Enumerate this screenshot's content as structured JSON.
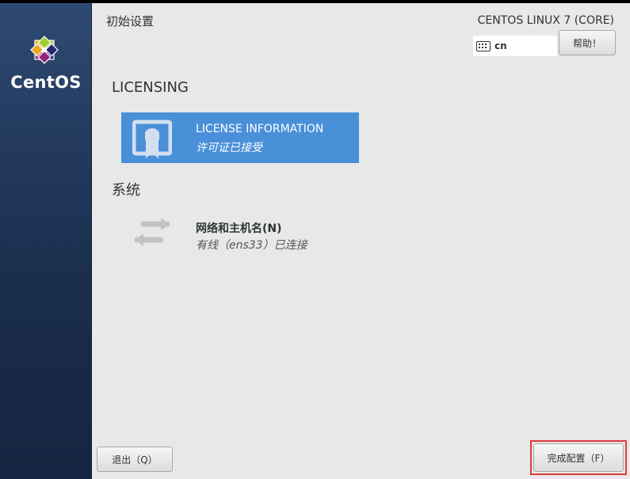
{
  "sidebar": {
    "brand": "CentOS"
  },
  "header": {
    "title": "初始设置",
    "product": "CENTOS LINUX 7 (CORE)",
    "keyboard_layout": "cn",
    "help_label": "帮助！"
  },
  "sections": [
    {
      "title": "LICENSING",
      "spokes": [
        {
          "title": "LICENSE INFORMATION",
          "status": "许可证已接受",
          "icon": "license-certificate-icon",
          "selected": true
        }
      ]
    },
    {
      "title": "系统",
      "spokes": [
        {
          "title": "网络和主机名(N)",
          "status": "有线（ens33）已连接",
          "icon": "network-arrows-icon",
          "selected": false
        }
      ]
    }
  ],
  "footer": {
    "quit_label": "退出（Q）",
    "finish_label": "完成配置（F）"
  },
  "colors": {
    "selected_spoke": "#4a90d9",
    "sidebar_top": "#2f4a72",
    "sidebar_bottom": "#152441",
    "highlight_frame": "#e03a3a"
  }
}
